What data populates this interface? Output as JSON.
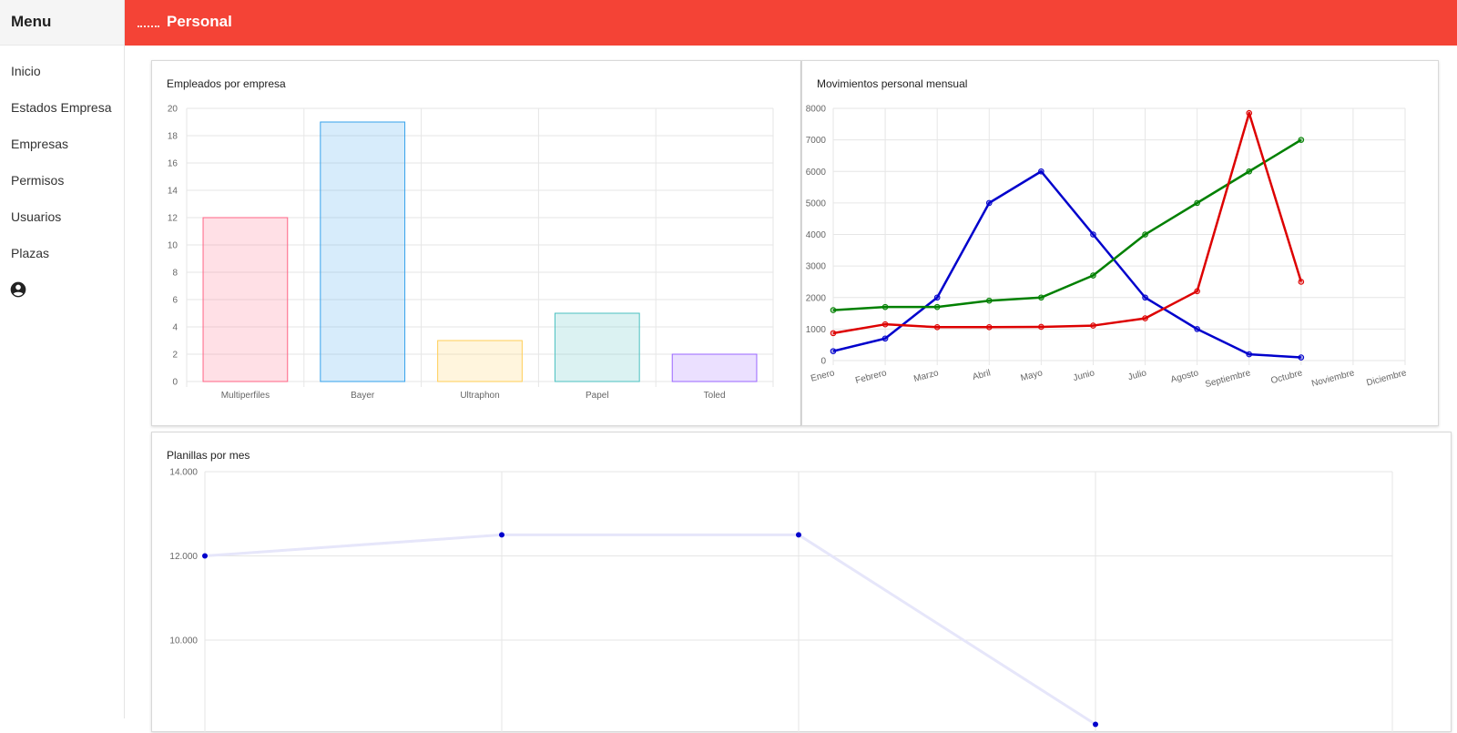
{
  "sidebar": {
    "menu_title": "Menu",
    "items": [
      {
        "label": "Inicio"
      },
      {
        "label": "Estados Empresa"
      },
      {
        "label": "Empresas"
      },
      {
        "label": "Permisos"
      },
      {
        "label": "Usuarios"
      },
      {
        "label": "Plazas"
      }
    ],
    "user_icon": "account-circle-icon"
  },
  "topbar": {
    "title": "Personal",
    "color": "#f44336"
  },
  "chart_data": [
    {
      "type": "bar",
      "title": "Empleados por empresa",
      "categories": [
        "Multiperfiles",
        "Bayer",
        "Ultraphon",
        "Papel",
        "Toled"
      ],
      "values": [
        12,
        19,
        3,
        5,
        2
      ],
      "ylim": [
        0,
        20
      ],
      "yticks": [
        "0",
        "2",
        "4",
        "6",
        "8",
        "10",
        "12",
        "14",
        "16",
        "18",
        "20"
      ],
      "colors": [
        "#ff6384",
        "#36a2eb",
        "#ffce56",
        "#4bc0c0",
        "#9966ff"
      ],
      "grid": true
    },
    {
      "type": "line",
      "title": "Movimientos personal mensual",
      "categories": [
        "Enero",
        "Febrero",
        "Marzo",
        "Abril",
        "Mayo",
        "Junio",
        "Julio",
        "Agosto",
        "Septiembre",
        "Octubre",
        "Noviembre",
        "Diciembre"
      ],
      "ylim": [
        0,
        8000
      ],
      "yticks": [
        "0",
        "1000",
        "2000",
        "3000",
        "4000",
        "5000",
        "6000",
        "7000",
        "8000"
      ],
      "series": [
        {
          "color": "#0000cc",
          "values": [
            300,
            700,
            2000,
            5000,
            6000,
            4000,
            2000,
            1000,
            200,
            100
          ]
        },
        {
          "color": "#008000",
          "values": [
            1600,
            1700,
            1700,
            1900,
            2000,
            2700,
            4000,
            5000,
            6000,
            7000
          ]
        },
        {
          "color": "#dd0000",
          "values": [
            870,
            1150,
            1060,
            1060,
            1070,
            1110,
            1340,
            2200,
            7850,
            2500
          ]
        }
      ],
      "grid": true
    },
    {
      "type": "line",
      "title": "Planillas por mes",
      "ylim": [
        8000,
        14000
      ],
      "yticks": [
        "14.000",
        "12.000",
        "10.000"
      ],
      "ytick_values": [
        14000,
        12000,
        10000
      ],
      "x_count": 5,
      "series": [
        {
          "color": "#0000cc",
          "values": [
            12000,
            12500,
            12500,
            8000
          ]
        }
      ],
      "grid": true
    }
  ]
}
